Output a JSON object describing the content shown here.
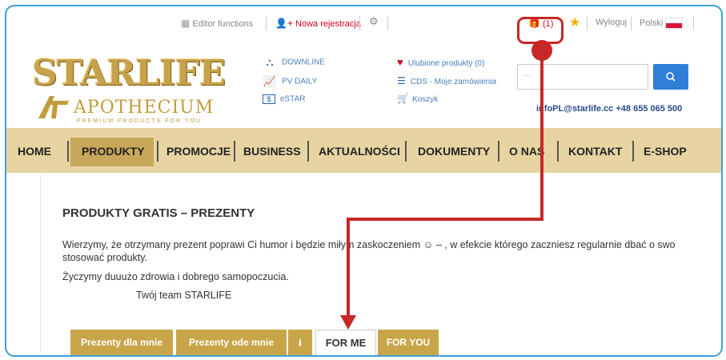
{
  "topbar": {
    "editor_label": "Editor functions",
    "register_label": "Nowa rejestracja",
    "gift_count": "(1)",
    "logout_label": "Wyloguj",
    "language_label": "Polski"
  },
  "logo": {
    "brand": "STARLIFE",
    "sub_brand": "APOTHECIUM",
    "tagline": "PREMIUM PRODUCTS FOR YOU"
  },
  "links": {
    "downline": "DOWNLINE",
    "pv_daily": "PV DAILY",
    "estar": "eSTAR",
    "favorites": "Ulubione produkty (0)",
    "orders": "CDS - Moje zamówienia",
    "cart": "Koszyk"
  },
  "search": {
    "placeholder": "..."
  },
  "contact": "infoPL@starlife.cc +48 655 065 500",
  "nav": [
    "HOME",
    "PRODUKTY",
    "PROMOCJE",
    "BUSINESS",
    "AKTUALNOŚCI",
    "DOKUMENTY",
    "O NAS",
    "KONTAKT",
    "E-SHOP"
  ],
  "content": {
    "title": "PRODUKTY GRATIS – PREZENTY",
    "para1_line1": "Wierzymy, że otrzymany prezent poprawi Ci humor i będzie miłym zaskoczeniem ☺ – , w efekcie którego zaczniesz regularnie dbać o swo",
    "para1_line2": "stosować produkty.",
    "para2": "Życzymy duuużo zdrowia i dobrego samopoczucia.",
    "signature": "Twój team STARLIFE"
  },
  "tabs": [
    "Prezenty dla mnie",
    "Prezenty ode mnie",
    "FOR ME",
    "FOR YOU"
  ],
  "colors": {
    "accent_gold": "#c9a54a",
    "nav_bg": "#e8d4a2",
    "highlight_red": "#c62828",
    "frame_blue": "#3aa0d8"
  }
}
